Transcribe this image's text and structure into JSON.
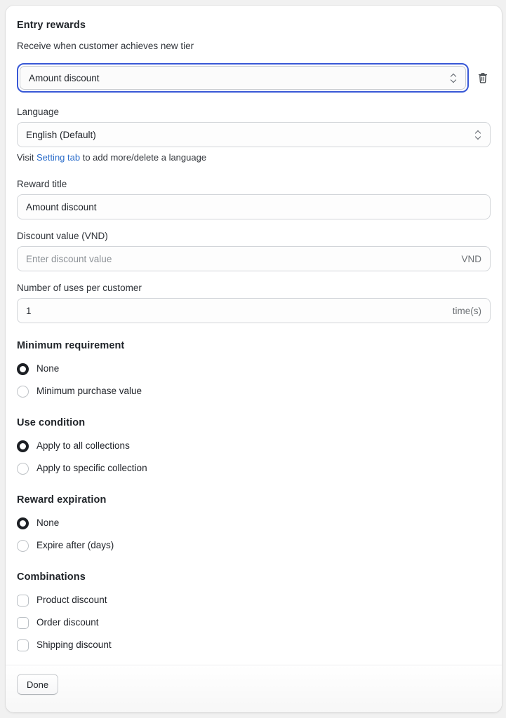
{
  "header": {
    "title": "Entry rewards",
    "subtitle": "Receive when customer achieves new tier"
  },
  "reward_type": {
    "selected": "Amount discount",
    "delete_icon": "trash-icon",
    "chevron_icon": "chevron-updown-icon"
  },
  "language": {
    "label": "Language",
    "selected": "English (Default)",
    "hint_prefix": "Visit ",
    "hint_link": "Setting tab",
    "hint_suffix": " to add more/delete a language"
  },
  "reward_title": {
    "label": "Reward title",
    "value": "Amount discount"
  },
  "discount_value": {
    "label": "Discount value (VND)",
    "placeholder": "Enter discount value",
    "value": "",
    "suffix": "VND"
  },
  "uses": {
    "label": "Number of uses per customer",
    "value": "1",
    "suffix": "time(s)"
  },
  "minimum_requirement": {
    "title": "Minimum requirement",
    "options": [
      {
        "label": "None",
        "selected": true
      },
      {
        "label": "Minimum purchase value",
        "selected": false
      }
    ]
  },
  "use_condition": {
    "title": "Use condition",
    "options": [
      {
        "label": "Apply to all collections",
        "selected": true
      },
      {
        "label": "Apply to specific collection",
        "selected": false
      }
    ]
  },
  "reward_expiration": {
    "title": "Reward expiration",
    "options": [
      {
        "label": "None",
        "selected": true
      },
      {
        "label": "Expire after (days)",
        "selected": false
      }
    ]
  },
  "combinations": {
    "title": "Combinations",
    "options": [
      {
        "label": "Product discount",
        "checked": false
      },
      {
        "label": "Order discount",
        "checked": false
      },
      {
        "label": "Shipping discount",
        "checked": false
      }
    ]
  },
  "footer": {
    "done_label": "Done"
  },
  "colors": {
    "focus_ring": "#3858d6",
    "link": "#2c6ecb",
    "radio_selected": "#1c1f24",
    "page_bg": "#f1f1f1",
    "card_bg": "#ffffff"
  }
}
